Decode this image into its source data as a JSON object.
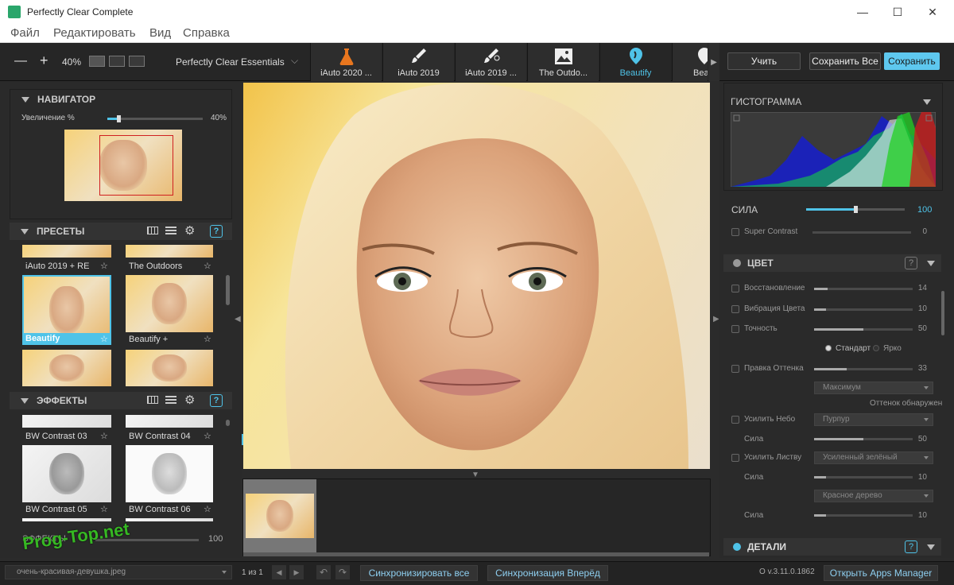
{
  "window": {
    "title": "Perfectly Clear Complete",
    "minimize": "—",
    "maximize": "☐",
    "close": "✕"
  },
  "menu": [
    "Файл",
    "Редактировать",
    "Вид",
    "Справка"
  ],
  "toolbar": {
    "zoom_minus": "—",
    "zoom_plus": "+",
    "zoom": "40%",
    "preset_group": "Perfectly Clear Essentials",
    "tabs": [
      {
        "label": "iAuto 2020 ...",
        "icon": "flask-icon"
      },
      {
        "label": "iAuto 2019",
        "icon": "brush-2019-icon"
      },
      {
        "label": "iAuto 2019 ...",
        "icon": "brush-eye-2019-icon"
      },
      {
        "label": "The Outdo...",
        "icon": "landscape-icon"
      },
      {
        "label": "Beautify",
        "icon": "beautify-icon"
      },
      {
        "label": "Beau",
        "icon": "beautify-icon"
      }
    ],
    "learn": "Учить",
    "save_all": "Сохранить Все",
    "save": "Сохранить"
  },
  "navigator": {
    "title": "НАВИГАТОР",
    "zoom_label": "Увеличение %",
    "zoom_value": "40%",
    "zoom_fraction": 0.12
  },
  "presets": {
    "title": "ПРЕСЕТЫ",
    "items": [
      {
        "label": "iAuto 2019 + RE",
        "selected": false
      },
      {
        "label": "The Outdoors",
        "selected": false
      },
      {
        "label": "Beautify",
        "selected": true
      },
      {
        "label": "Beautify +",
        "selected": false
      }
    ]
  },
  "effects": {
    "title": "ЭФФЕКТЫ",
    "items": [
      "BW Contrast 03",
      "BW Contrast 04",
      "BW Contrast 05",
      "BW Contrast 06"
    ],
    "amount_label": "ЭФФЕКТЫ",
    "amount_value": "100"
  },
  "histogram": {
    "title": "ГИСТОГРАММА"
  },
  "strength": {
    "label": "СИЛА",
    "value": "100",
    "fraction": 0.5
  },
  "super_contrast": {
    "label": "Super Contrast",
    "value": "0"
  },
  "color": {
    "title": "ЦВЕТ",
    "help": "?",
    "restoration": {
      "label": "Восстановление",
      "value": "14"
    },
    "vibrancy": {
      "label": "Вибрация Цвета",
      "value": "10"
    },
    "accuracy": {
      "label": "Точность",
      "value": "50"
    },
    "mode_standard": "Стандарт",
    "mode_bright": "Ярко",
    "tint": {
      "label": "Правка Оттенка",
      "value": "33",
      "select": "Максимум",
      "detected": "Оттенок обнаружен"
    },
    "sky": {
      "label": "Усилить Небо",
      "select": "Пурпур",
      "strength_label": "Сила",
      "value": "50"
    },
    "foliage": {
      "label": "Усилить Листву",
      "select": "Усиленный зелёный",
      "strength_label": "Сила",
      "value": "10",
      "select2": "Красное дерево",
      "strength2_label": "Сила",
      "value2": "10"
    }
  },
  "details": {
    "title": "ДЕТАЛИ",
    "help": "?"
  },
  "status": {
    "filename": "очень-красивая-девушка.jpeg",
    "counter": "1 из 1",
    "sync_all": "Синхронизировать все",
    "sync_forward": "Синхронизация Вперёд",
    "version": "v.3.11.0.1862",
    "apps_manager": "Открыть Apps Manager"
  },
  "watermark": "Prog-Top.net",
  "colors": {
    "accent": "#4fc3e8",
    "bg": "#2a2a2a"
  }
}
